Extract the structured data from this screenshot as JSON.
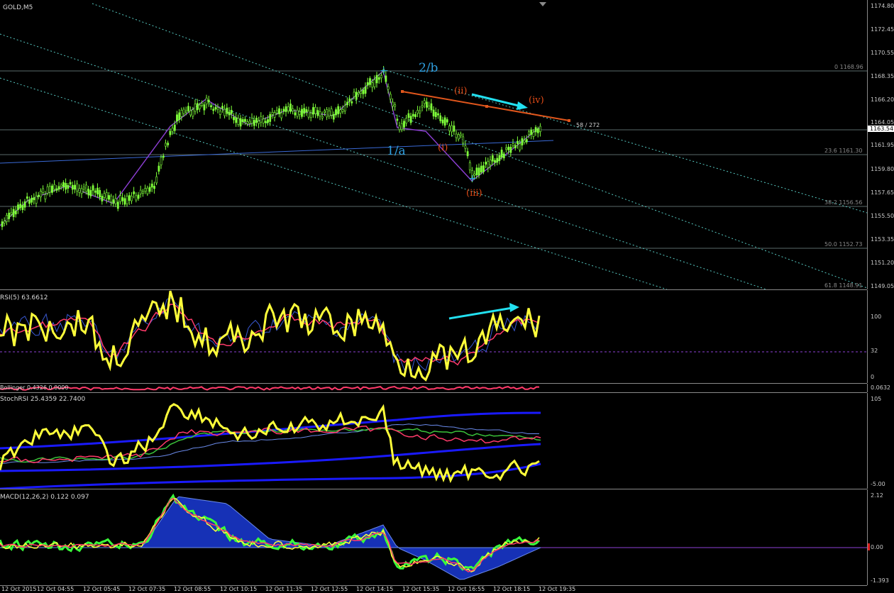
{
  "symbol": "GOLD,M5",
  "main": {
    "price_ticks": [
      "1174.80",
      "1172.45",
      "1170.55",
      "1168.35",
      "1166.20",
      "1164.05",
      "1161.95",
      "1159.80",
      "1157.65",
      "1155.50",
      "1153.35",
      "1151.20",
      "1149.05"
    ],
    "current_price": "1163.54",
    "spread_label": "58 / 272",
    "fib_levels": [
      {
        "label": "0 1168.96"
      },
      {
        "label": "23.6 1161.30"
      },
      {
        "label": "38.2 1156.56"
      },
      {
        "label": "50.0 1152.73"
      },
      {
        "label": "61.8 1148.91"
      }
    ],
    "wave_labels": {
      "major_2b": "2/b",
      "major_1a": "1/a",
      "minor_i": "(i)",
      "minor_ii": "(ii)",
      "minor_iii": "(iii)",
      "minor_iv": "(iv)"
    }
  },
  "rsi": {
    "title": "RSI(5) 63.6612",
    "ticks": [
      "100",
      "32",
      "0"
    ]
  },
  "mini": {
    "title": "Bollinger 0.4326 0.0000",
    "tick": "0.0632"
  },
  "stochrsi": {
    "title": "StochRSI 25.4359 22.7400",
    "ticks": [
      "105",
      "-5.00"
    ]
  },
  "macd": {
    "title": "MACD(12,26,2) 0.122 0.097",
    "ticks": [
      "2.12",
      "0.00",
      "-1.393"
    ]
  },
  "time_labels": [
    "12 Oct 2015",
    "12 Oct 04:55",
    "12 Oct 05:45",
    "12 Oct 07:35",
    "12 Oct 08:55",
    "12 Oct 10:15",
    "12 Oct 11:35",
    "12 Oct 12:55",
    "12 Oct 14:15",
    "12 Oct 15:35",
    "12 Oct 16:55",
    "12 Oct 18:15",
    "12 Oct 19:35"
  ],
  "colors": {
    "candle": "#7fff3a",
    "zigzag": "#8e3fd6",
    "channel": "#56c7c0",
    "wave_blue": "#2f9fe0",
    "wave_red": "#e04a16",
    "rsi_main": "#ffff3a",
    "arrow": "#22e0f0"
  }
}
